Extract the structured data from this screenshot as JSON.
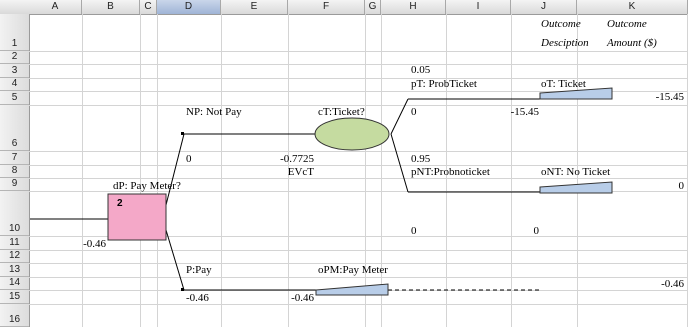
{
  "columns": [
    "A",
    "B",
    "C",
    "D",
    "E",
    "F",
    "G",
    "H",
    "I",
    "J",
    "K"
  ],
  "selected_column": "D",
  "rows": [
    "1",
    "2",
    "3",
    "4",
    "5",
    "6",
    "7",
    "8",
    "9",
    "10",
    "11",
    "12",
    "13",
    "14",
    "15",
    "16"
  ],
  "cells": {
    "J1a": "Outcome",
    "J1b": "Desciption",
    "K1a": "Outcome",
    "K1b": "Amount ($)",
    "H2": "0.05",
    "H3": "pT: ProbTicket",
    "J3": "oT: Ticket",
    "K4": "-15.45",
    "D5": "NP: Not Pay",
    "F5": "cT:Ticket?",
    "H5": "0",
    "I5": "-15.45",
    "D7": "0",
    "E7": "-0.7725",
    "H7": "0.95",
    "E8": "EVcT",
    "H8": "pNT:Probnoticket",
    "J8": "oNT: No Ticket",
    "B9": "dP: Pay Meter?",
    "K9": "0",
    "B10": "2",
    "H10": "0",
    "I10": "0",
    "A11": "-0.46",
    "D13": "P:Pay",
    "F13": "oPM:Pay Meter",
    "K14": "-0.46",
    "D15": "-0.46",
    "E15": "-0.46"
  },
  "colors": {
    "decision_node": "#f4a8c8",
    "chance_node": "#c5dba0",
    "terminal_node": "#b8cde8",
    "header_selected": "#b3c5e1"
  }
}
